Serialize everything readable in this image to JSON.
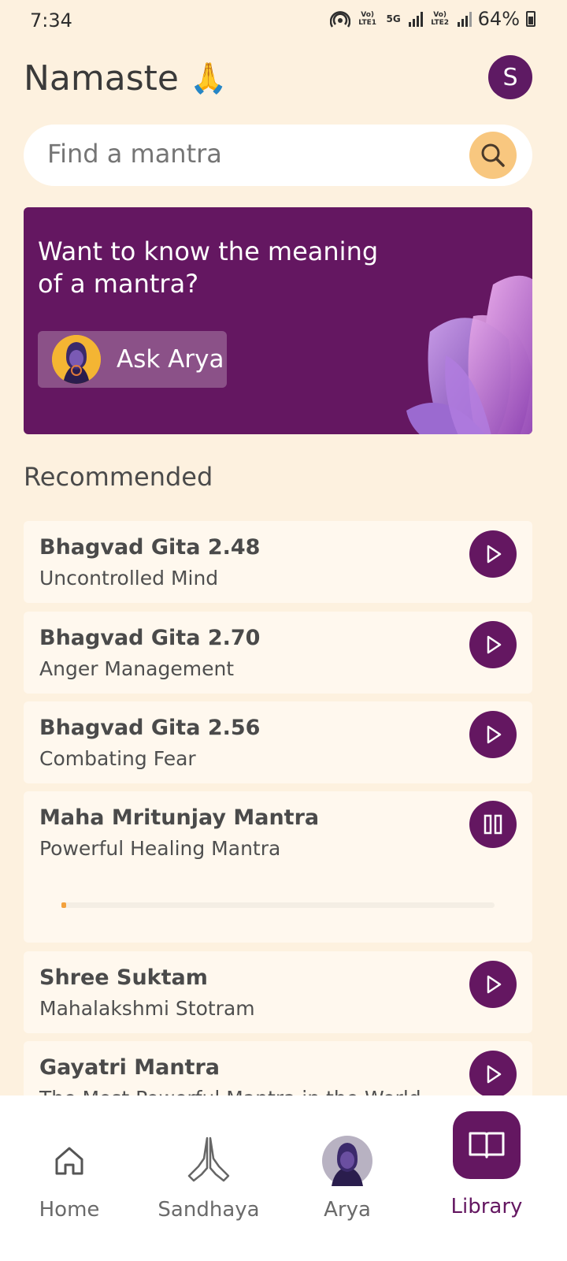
{
  "status_bar": {
    "time": "7:34",
    "network_lte1": "Vo) LTE1",
    "network_5g": "5G",
    "network_lte2": "Vo) LTE2",
    "battery": "64%"
  },
  "header": {
    "greeting": "Namaste",
    "greeting_emoji": "🙏",
    "avatar_initial": "S"
  },
  "search": {
    "placeholder": "Find a mantra"
  },
  "banner": {
    "text": "Want to know the meaning of a mantra?",
    "button_label": "Ask Arya"
  },
  "recommended": {
    "title": "Recommended",
    "items": [
      {
        "title": "Bhagvad Gita 2.48",
        "subtitle": "Uncontrolled Mind",
        "state": "play"
      },
      {
        "title": "Bhagvad Gita 2.70",
        "subtitle": "Anger Management",
        "state": "play"
      },
      {
        "title": "Bhagvad Gita 2.56",
        "subtitle": "Combating Fear",
        "state": "play"
      },
      {
        "title": "Maha Mritunjay Mantra",
        "subtitle": "Powerful Healing Mantra",
        "state": "pause",
        "progress": 0.01
      },
      {
        "title": "Shree Suktam",
        "subtitle": "Mahalakshmi Stotram",
        "state": "play"
      },
      {
        "title": "Gayatri Mantra",
        "subtitle": "The Most Powerful Mantra in the World",
        "state": "play"
      }
    ]
  },
  "nav": {
    "items": [
      {
        "label": "Home",
        "icon": "home-icon"
      },
      {
        "label": "Sandhaya",
        "icon": "praying-hands-icon"
      },
      {
        "label": "Arya",
        "icon": "arya-avatar"
      },
      {
        "label": "Library",
        "icon": "book-icon",
        "active": true
      }
    ]
  },
  "colors": {
    "background": "#fdf1df",
    "brand_purple": "#641761",
    "search_accent": "#f8c77f",
    "progress": "#f3a13c"
  }
}
